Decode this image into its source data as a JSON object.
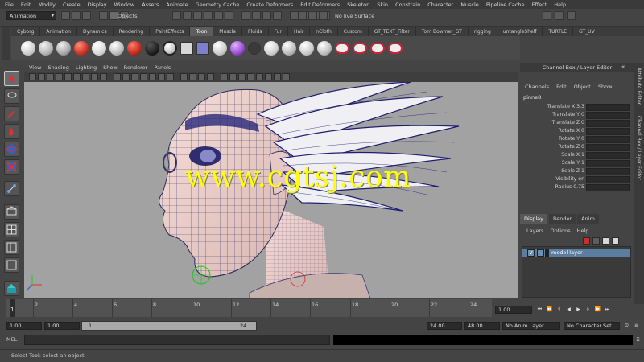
{
  "menubar": {
    "items": [
      "File",
      "Edit",
      "Modify",
      "Create",
      "Display",
      "Window",
      "Assets",
      "Animate",
      "Geometry Cache",
      "Create Deformers",
      "Edit Deformers",
      "Skeleton",
      "Skin",
      "Constrain",
      "Character",
      "Muscle",
      "Pipeline Cache",
      "Effect",
      "Help"
    ]
  },
  "status_line": {
    "mode": "Animation",
    "objects_label": "Objects",
    "input_label": "No live Surface"
  },
  "shelf": {
    "tabs": [
      "Cyborg",
      "Animation",
      "Dynamics",
      "Rendering",
      "PaintEffects",
      "Toon",
      "Muscle",
      "Fluids",
      "Fur",
      "Hair",
      "nCloth",
      "Custom",
      "GT_TEXT_Filter",
      "Tom Bowmer_GT",
      "rigging",
      "untangleShelf",
      "TURTLE",
      "GT_UV"
    ],
    "active_tab": "Toon",
    "colors": {
      "white": "#f2f2f2",
      "grey": "#bdbdbd",
      "red": "#d13a2a",
      "dark": "#202020"
    }
  },
  "viewport": {
    "menu": [
      "View",
      "Shading",
      "Lighting",
      "Show",
      "Renderer",
      "Panels"
    ],
    "background": "#a2a2a2"
  },
  "channel_box": {
    "header": "Channel Box / Layer Editor",
    "menu": [
      "Channels",
      "Edit",
      "Object",
      "Show"
    ],
    "object_name": "pinne8",
    "attributes": [
      "Translate X 3.3",
      "Translate Y 0",
      "Translate Z 0",
      "Rotate X 0",
      "Rotate Y 0",
      "Rotate Z 0",
      "Scale X 1",
      "Scale Y 1",
      "Scale Z 1",
      "Visibility on",
      "Radius 0.75"
    ],
    "side_tabs": [
      "Attribute Editor",
      "Channel Box / Layer Editor"
    ]
  },
  "layer_editor": {
    "tabs": [
      "Display",
      "Render",
      "Anim"
    ],
    "active_tab": "Display",
    "menu": [
      "Layers",
      "Options",
      "Help"
    ],
    "layers": [
      {
        "flag": "V",
        "name": "model layer"
      }
    ]
  },
  "time_slider": {
    "current_frame": "1",
    "ticks": [
      "2",
      "4",
      "6",
      "8",
      "10",
      "12",
      "14",
      "16",
      "18",
      "20",
      "22",
      "24"
    ],
    "current_time_field": "1.00"
  },
  "range_slider": {
    "start_time": "1.00",
    "playback_start": "1.00",
    "range_start_label": "1",
    "range_end_label": "24",
    "playback_end": "24.00",
    "end_time": "48.00",
    "anim_layer": "No Anim Layer",
    "character_set": "No Character Set"
  },
  "command_line": {
    "label": "MEL"
  },
  "help_line": {
    "text": "Select Tool: select an object"
  },
  "watermark": {
    "text": "www.cgtsj.com"
  }
}
